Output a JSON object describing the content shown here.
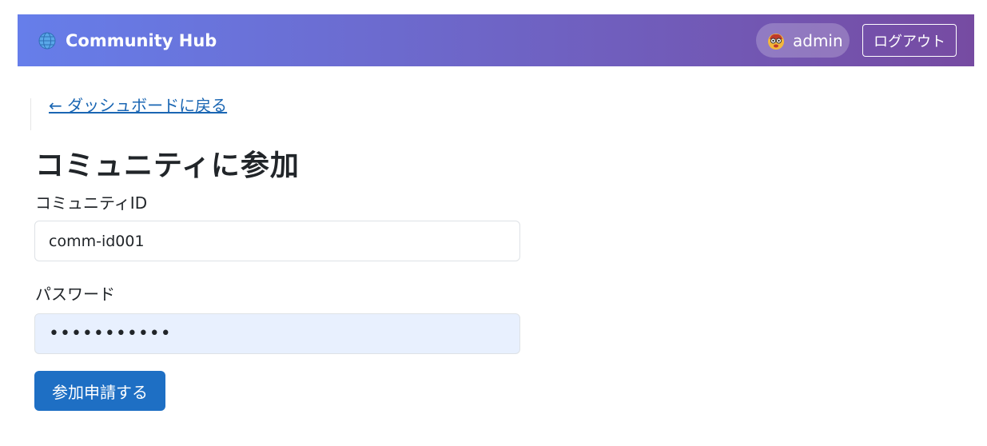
{
  "header": {
    "brand_name": "Community Hub",
    "brand_icon": "globe-icon",
    "user_name": "admin",
    "user_avatar_icon": "emoji-face-avatar",
    "logout_label": "ログアウト",
    "gradient_start": "#667eea",
    "gradient_end": "#764ba2"
  },
  "nav": {
    "back_link": "← ダッシュボードに戻る"
  },
  "page": {
    "title": "コミュニティに参加"
  },
  "form": {
    "community_id_label": "コミュニティID",
    "community_id_value": "comm-id001",
    "password_label": "パスワード",
    "password_value": "•••••••••••",
    "submit_label": "参加申請する",
    "submit_color": "#1e6fc4"
  }
}
